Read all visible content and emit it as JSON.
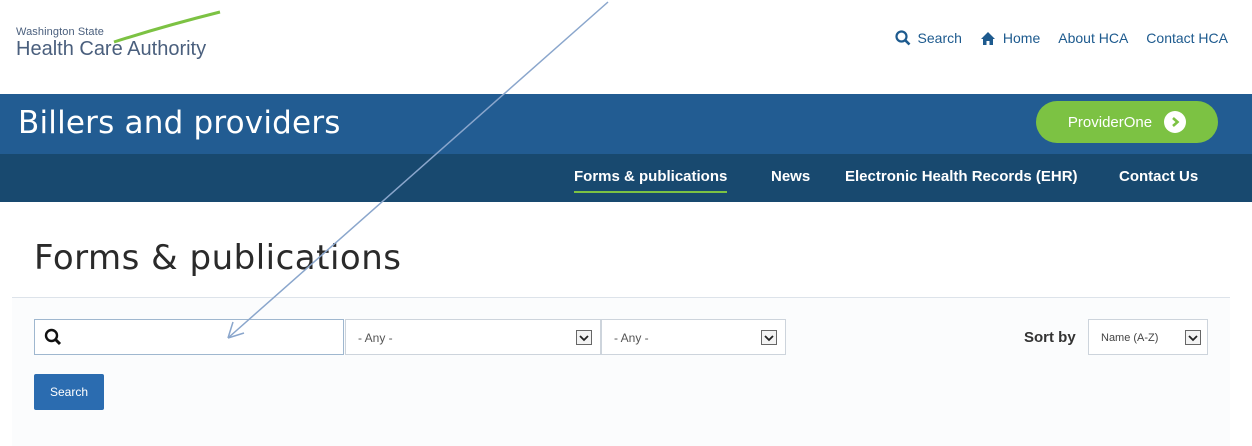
{
  "logo": {
    "line1": "Washington State",
    "line2": "Health Care Authority"
  },
  "utility_nav": {
    "search_label": "Search",
    "home_label": "Home",
    "about_label": "About HCA",
    "contact_label": "Contact HCA"
  },
  "banner": {
    "title": "Billers and providers",
    "provider_button": "ProviderOne"
  },
  "main_nav": {
    "tabs": [
      {
        "label": "Forms & publications",
        "active": true
      },
      {
        "label": "News",
        "active": false
      },
      {
        "label": "Electronic Health Records (EHR)",
        "active": false
      },
      {
        "label": "Contact Us",
        "active": false
      }
    ]
  },
  "page": {
    "title": "Forms & publications"
  },
  "filters": {
    "search_value": "",
    "select1_value": "- Any -",
    "select2_value": "- Any -",
    "sort_label": "Sort by",
    "sort_value": "Name (A-Z)",
    "search_button": "Search"
  },
  "colors": {
    "banner": "#225c92",
    "navbar": "#18496f",
    "accent_green": "#7cc243",
    "link_blue": "#1d5a8e",
    "button_blue": "#2b6cb0"
  },
  "icons": [
    "search-icon",
    "home-icon",
    "chevron-right-icon",
    "chevron-down-icon"
  ]
}
